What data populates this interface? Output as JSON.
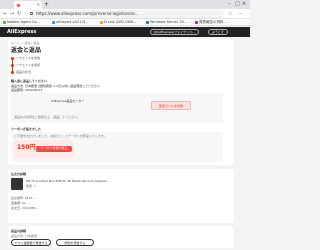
{
  "browser": {
    "url": "https://www.aliexpress.com/p/reverse-logistics/se...",
    "new_tab": "+",
    "bookmarks": [
      {
        "label": "Natalie Agent Co..."
      },
      {
        "label": "uBlizcart vA21 N..."
      },
      {
        "label": "D sink DVD-GDB..."
      },
      {
        "label": "Windows Server 20..."
      },
      {
        "label": "発表報告の資料..."
      }
    ]
  },
  "header": {
    "logo": "AliExpress",
    "ship_to": "JP/AliExpress/ファイナンス...",
    "account": "ようこそ"
  },
  "breadcrumb": "ホーム > 返金と返品",
  "page_title": "返金と返品",
  "steps": [
    {
      "label": "リクエストを送信"
    },
    {
      "label": "リクエストを承認"
    },
    {
      "label": "返品の状況"
    }
  ],
  "return_section": {
    "heading": "購入者に返品してください",
    "line1": "返品方法: 日本郵便 (国際郵便) 1-2日以内に返品発送してください",
    "line2": "返品期限: 2022/09/22",
    "box_label": "AliExpress返品センター",
    "box_button": "配送ラベルを印刷",
    "info_text": "返品先の住所をご確認の上、返品してください。",
    "coupon_heading": "クーポンが届きました",
    "coupon_text": "ご不便をおかけしました。お詫びとしてクーポンを贈呈いたします。",
    "coupon_amount": "150円",
    "coupon_action": "クーポンを受け取る"
  },
  "order_section": {
    "heading": "注文の詳細",
    "product_title": "SD TV Junction Box PCB for Mi Robot Vacuum Cleaner...",
    "product_sub": "数量: 1",
    "detail1": "注文番号: 8151...",
    "detail2": "返金額: ¥1,...",
    "detail3": "注文日: 2022/08/..."
  },
  "return_detail_section": {
    "heading": "返品の詳細",
    "text": "返品方法: 日本郵便",
    "btn1": "ヤマト運輸便で発送する",
    "btn2": "問題を報告する"
  }
}
